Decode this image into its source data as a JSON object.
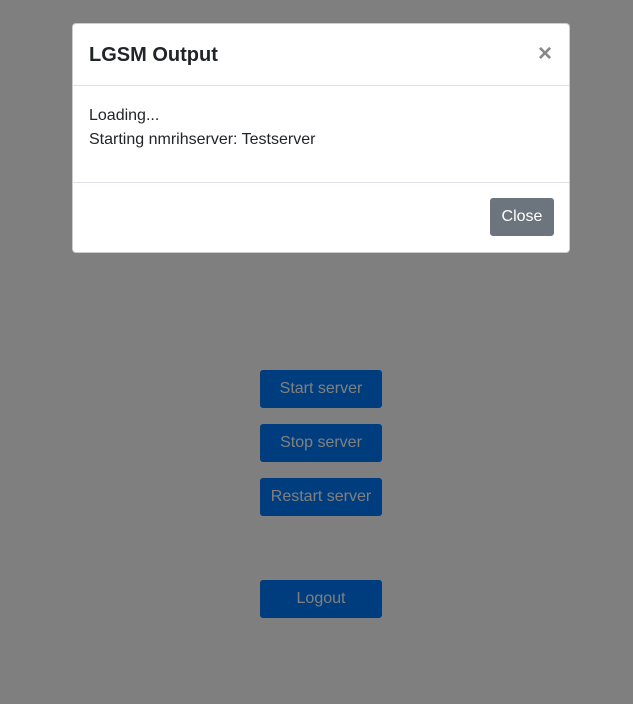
{
  "page": {
    "buttons": {
      "start": "Start server",
      "stop": "Stop server",
      "restart": "Restart server",
      "logout": "Logout"
    }
  },
  "modal": {
    "title": "LGSM Output",
    "close_icon": "×",
    "body_lines": [
      "Loading...",
      "Starting nmrihserver: Testserver"
    ],
    "close_button": "Close"
  },
  "colors": {
    "primary": "#007bff",
    "secondary": "#6c757d",
    "backdrop": "rgba(0,0,0,0.5)"
  }
}
